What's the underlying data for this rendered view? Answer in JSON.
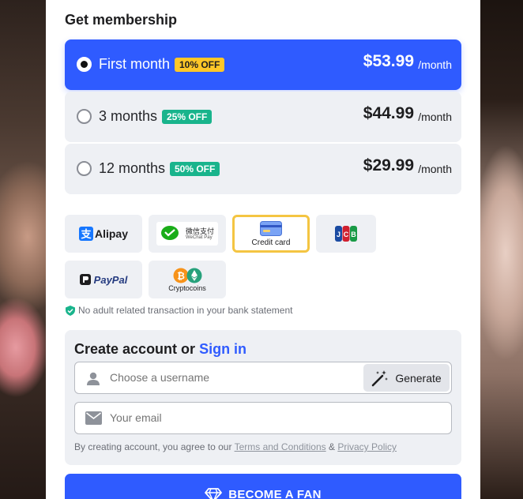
{
  "title": "Get membership",
  "plans": [
    {
      "name": "First month",
      "badge": "10% OFF",
      "price": "$53.99",
      "per": "/month"
    },
    {
      "name": "3 months",
      "badge": "25% OFF",
      "price": "$44.99",
      "per": "/month"
    },
    {
      "name": "12 months",
      "badge": "50% OFF",
      "price": "$29.99",
      "per": "/month"
    }
  ],
  "payments": {
    "alipay": "Alipay",
    "wechat_cn": "微信支付",
    "wechat_en": "WeChat Pay",
    "credit_card": "Credit card",
    "jcb": "JCB",
    "paypal": "PayPal",
    "crypto": "Cryptocoins"
  },
  "note": "No adult related transaction in your bank statement",
  "account": {
    "title": "Create account or",
    "sign_in": "Sign in",
    "username_placeholder": "Choose a username",
    "generate": "Generate",
    "email_placeholder": "Your email",
    "terms_prefix": "By creating account, you agree to our",
    "terms_link": "Terms and Conditions",
    "amp": "&",
    "privacy_link": "Privacy Policy"
  },
  "cta": "BECOME A FAN",
  "colors": {
    "accent": "#2f5bff",
    "selected_badge": "#ffc728",
    "discount_badge": "#19b48c",
    "card_border": "#f4c542"
  }
}
